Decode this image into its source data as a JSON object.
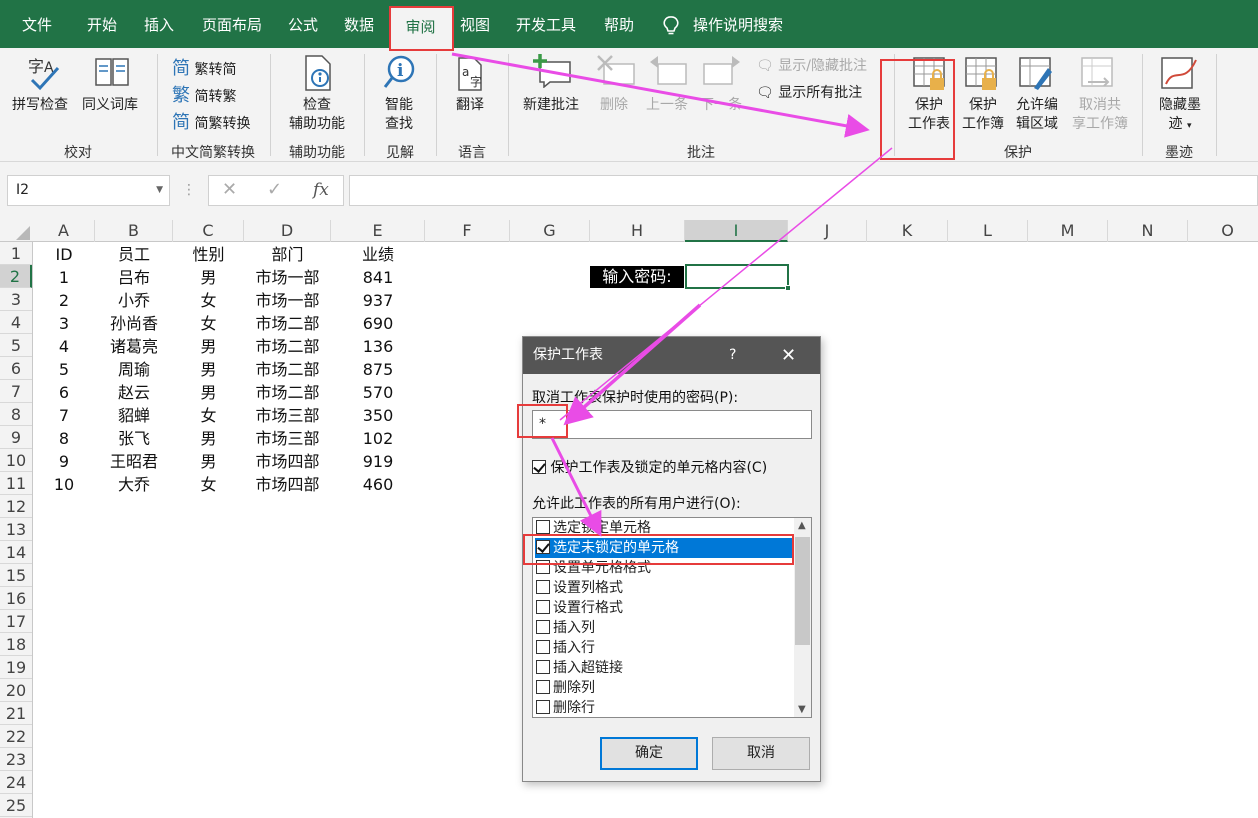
{
  "tabs": {
    "file": "文件",
    "home": "开始",
    "insert": "插入",
    "layout": "页面布局",
    "formulas": "公式",
    "data": "数据",
    "review": "审阅",
    "view": "视图",
    "developer": "开发工具",
    "help": "帮助",
    "tellme": "操作说明搜索"
  },
  "ribbon": {
    "spell": "拼写检查",
    "thesaurus": "同义词库",
    "grp_proof": "校对",
    "trad_to_simp": "繁转简",
    "simp_to_trad": "简转繁",
    "convert": "简繁转换",
    "grp_chinese": "中文简繁转换",
    "access_1": "检查",
    "access_2": "辅助功能",
    "grp_access": "辅助功能",
    "smart_1": "智能",
    "smart_2": "查找",
    "grp_insights": "见解",
    "translate": "翻译",
    "grp_lang": "语言",
    "new_comment": "新建批注",
    "delete": "删除",
    "prev": "上一条",
    "next": "下一条",
    "show_hide": "显示/隐藏批注",
    "show_all": "显示所有批注",
    "grp_comments": "批注",
    "protect_sheet_1": "保护",
    "protect_sheet_2": "工作表",
    "protect_wb_1": "保护",
    "protect_wb_2": "工作簿",
    "allow_edit_1": "允许编",
    "allow_edit_2": "辑区域",
    "unshare_1": "取消共",
    "unshare_2": "享工作簿",
    "grp_protect": "保护",
    "hide_ink_1": "隐藏墨",
    "hide_ink_2": "迹",
    "grp_ink": "墨迹"
  },
  "formula_bar": {
    "name_box": "I2",
    "cancel": "✕",
    "enter": "✓",
    "fx": "fx",
    "value": ""
  },
  "columns": [
    "A",
    "B",
    "C",
    "D",
    "E",
    "F",
    "G",
    "H",
    "I",
    "J",
    "K",
    "L",
    "M",
    "N",
    "O"
  ],
  "rows": [
    "1",
    "2",
    "3",
    "4",
    "5",
    "6",
    "7",
    "8",
    "9",
    "10",
    "11",
    "12",
    "13",
    "14",
    "15",
    "16",
    "17",
    "18",
    "19",
    "20",
    "21",
    "22",
    "23",
    "24",
    "25"
  ],
  "table": {
    "headers": [
      "ID",
      "员工",
      "性别",
      "部门",
      "业绩"
    ],
    "records": [
      [
        "1",
        "吕布",
        "男",
        "市场一部",
        "841"
      ],
      [
        "2",
        "小乔",
        "女",
        "市场一部",
        "937"
      ],
      [
        "3",
        "孙尚香",
        "女",
        "市场二部",
        "690"
      ],
      [
        "4",
        "诸葛亮",
        "男",
        "市场二部",
        "136"
      ],
      [
        "5",
        "周瑜",
        "男",
        "市场二部",
        "875"
      ],
      [
        "6",
        "赵云",
        "男",
        "市场二部",
        "570"
      ],
      [
        "7",
        "貂蝉",
        "女",
        "市场三部",
        "350"
      ],
      [
        "8",
        "张飞",
        "男",
        "市场三部",
        "102"
      ],
      [
        "9",
        "王昭君",
        "男",
        "市场四部",
        "919"
      ],
      [
        "10",
        "大乔",
        "女",
        "市场四部",
        "460"
      ]
    ]
  },
  "password_label": "输入密码:",
  "dialog": {
    "title": "保护工作表",
    "help": "?",
    "close": "✕",
    "pw_label": "取消工作表保护时使用的密码(P):",
    "pw_value": "*",
    "protect_label": "保护工作表及锁定的单元格内容(C)",
    "allow_label": "允许此工作表的所有用户进行(O):",
    "options": [
      {
        "label": "选定锁定单元格",
        "checked": false
      },
      {
        "label": "选定未锁定的单元格",
        "checked": true
      },
      {
        "label": "设置单元格格式",
        "checked": false
      },
      {
        "label": "设置列格式",
        "checked": false
      },
      {
        "label": "设置行格式",
        "checked": false
      },
      {
        "label": "插入列",
        "checked": false
      },
      {
        "label": "插入行",
        "checked": false
      },
      {
        "label": "插入超链接",
        "checked": false
      },
      {
        "label": "删除列",
        "checked": false
      },
      {
        "label": "删除行",
        "checked": false
      }
    ],
    "ok": "确定",
    "cancel": "取消"
  },
  "colors": {
    "excel_green": "#217346",
    "annotation_red": "#e63b3b",
    "arrow_magenta": "#e94ce6",
    "selection_blue": "#0078d7"
  }
}
